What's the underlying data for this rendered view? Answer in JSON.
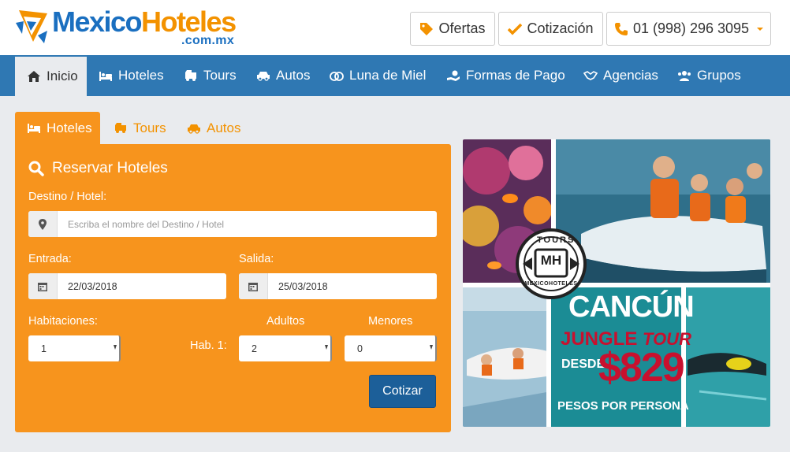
{
  "brand": {
    "name_part1": "Mexico",
    "name_part2": "Hoteles",
    "domain_suffix": ".com.mx",
    "colors": {
      "blue": "#1a6fc0",
      "orange": "#f39200",
      "nav": "#2f78b3"
    }
  },
  "header": {
    "offers_label": "Ofertas",
    "offers_icon": "tag-icon",
    "quote_label": "Cotización",
    "quote_icon": "check-icon",
    "phone_label": "01 (998) 296 3095",
    "phone_icon": "phone-icon"
  },
  "nav": {
    "items": [
      {
        "label": "Inicio",
        "icon": "home-icon",
        "active": true
      },
      {
        "label": "Hoteles",
        "icon": "bed-icon"
      },
      {
        "label": "Tours",
        "icon": "bus-icon"
      },
      {
        "label": "Autos",
        "icon": "car-icon"
      },
      {
        "label": "Luna de Miel",
        "icon": "rings-icon"
      },
      {
        "label": "Formas de Pago",
        "icon": "payment-icon"
      },
      {
        "label": "Agencias",
        "icon": "handshake-icon"
      },
      {
        "label": "Grupos",
        "icon": "users-icon"
      }
    ]
  },
  "tabs": [
    {
      "label": "Hoteles",
      "icon": "bed-icon",
      "active": true
    },
    {
      "label": "Tours",
      "icon": "bus-icon"
    },
    {
      "label": "Autos",
      "icon": "car-icon"
    }
  ],
  "booking": {
    "title": "Reservar Hoteles",
    "destination_label": "Destino / Hotel:",
    "destination_placeholder": "Escriba el nombre del Destino / Hotel",
    "checkin_label": "Entrada:",
    "checkin_value": "22/03/2018",
    "checkout_label": "Salida:",
    "checkout_value": "25/03/2018",
    "rooms_label": "Habitaciones:",
    "rooms_value": "1",
    "adults_label": "Adultos",
    "children_label": "Menores",
    "room_row_label": "Hab. 1:",
    "adults_value": "2",
    "children_value": "0",
    "submit_label": "Cotizar"
  },
  "promo": {
    "badge_top": "TOURS",
    "badge_center": "MH",
    "badge_bottom": "MEXICOHOTELES",
    "city": "CANCÚN",
    "tour_part1": "JUNGLE",
    "tour_part2": "TOUR",
    "from_label": "DESDE",
    "price": "$829",
    "per_person": "PESOS POR PERSONA",
    "colors": {
      "teal": "#1b8c95",
      "red": "#c8102e"
    }
  }
}
